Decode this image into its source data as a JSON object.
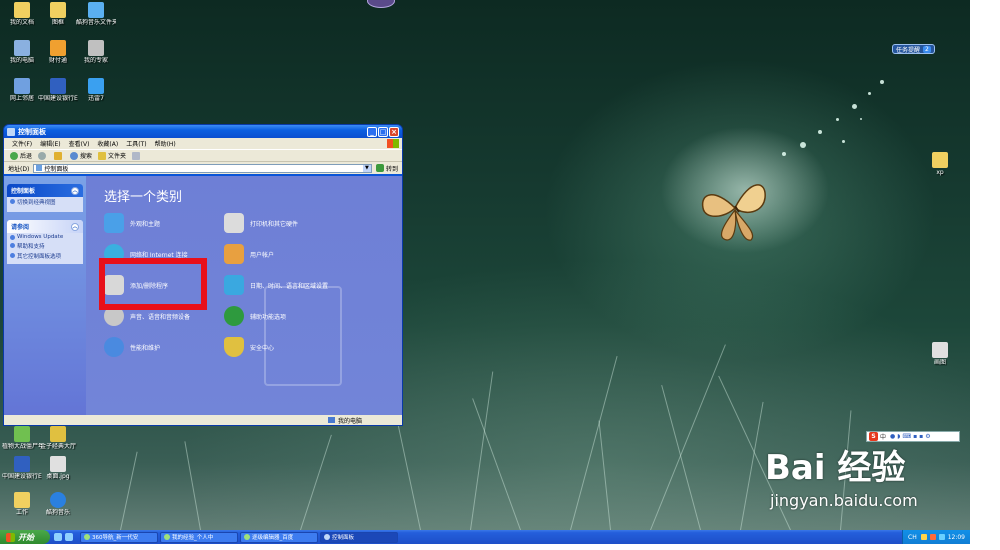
{
  "desktop": {
    "icons_top": [
      {
        "label": "我的文档"
      },
      {
        "label": "图框"
      },
      {
        "label": "酷狗音乐文件夹"
      },
      {
        "label": "我的电脑"
      },
      {
        "label": "财付通"
      },
      {
        "label": "我的专家"
      },
      {
        "label": "网上邻居"
      },
      {
        "label": "中国建设银行E路护航"
      },
      {
        "label": "迅雷7"
      }
    ],
    "icons_bottom": [
      {
        "label": "植物大战僵尸年度版"
      },
      {
        "label": "金子经典大厅"
      },
      {
        "label": "中国建设银行E路护航"
      },
      {
        "label": "桌面.jpg"
      },
      {
        "label": "工作"
      },
      {
        "label": "酷狗音乐"
      }
    ],
    "icons_right": [
      {
        "label": "xp"
      },
      {
        "label": "画图"
      }
    ]
  },
  "window": {
    "title": "控制面板",
    "menu": [
      "文件(F)",
      "编辑(E)",
      "查看(V)",
      "收藏(A)",
      "工具(T)",
      "帮助(H)"
    ],
    "toolbar": {
      "back": "后退",
      "search": "搜索",
      "folders": "文件夹"
    },
    "address": {
      "label": "地址(D)",
      "value": "控制面板",
      "go": "转到"
    },
    "left_panel": {
      "control_panel_header": "控制面板",
      "switch_view": "切换到经典视图",
      "see_also_header": "请参阅",
      "see_also_items": [
        "Windows Update",
        "帮助和支持",
        "其它控制面板选项"
      ]
    },
    "main": {
      "title": "选择一个类别",
      "categories": [
        {
          "label": "外观和主题",
          "icon": "appearance-icon",
          "color": "#4aa0e8"
        },
        {
          "label": "打印机和其它硬件",
          "icon": "printer-icon",
          "color": "#dcdcdc"
        },
        {
          "label": "网络和 Internet 连接",
          "icon": "network-icon",
          "color": "#3ab0e0"
        },
        {
          "label": "用户帐户",
          "icon": "users-icon",
          "color": "#e8a040"
        },
        {
          "label": "添加/删除程序",
          "icon": "add-remove-programs-icon",
          "color": "#d8d8d8"
        },
        {
          "label": "日期、时间、语言和区域设置",
          "icon": "date-time-icon",
          "color": "#3aa8e0"
        },
        {
          "label": "声音、语音和音频设备",
          "icon": "sound-icon",
          "color": "#c8c8c8"
        },
        {
          "label": "辅助功能选项",
          "icon": "accessibility-icon",
          "color": "#2e9a3e"
        },
        {
          "label": "性能和维护",
          "icon": "performance-icon",
          "color": "#4a8ae0"
        },
        {
          "label": "安全中心",
          "icon": "security-shield-icon",
          "color": "#e0c040"
        }
      ]
    },
    "status": "我的电脑"
  },
  "taskbar": {
    "start_label": "开始",
    "tasks": [
      {
        "label": "360导航_新一代安"
      },
      {
        "label": "我的经验_个人中"
      },
      {
        "label": "逐级编辑器_百度"
      },
      {
        "label": "控制面板"
      }
    ],
    "tray": {
      "lang": "CH",
      "time": "12:09"
    }
  },
  "overlays": {
    "task_badge": {
      "label": "任务提醒",
      "count": "2"
    },
    "ime_label": "中",
    "watermark_brand": "Bai 经验",
    "watermark_url": "jingyan.baidu.com"
  },
  "colors": {
    "highlight_box": "#e8101a",
    "window_blue": "#0a55d8",
    "pane_blue": "#7285d8"
  }
}
